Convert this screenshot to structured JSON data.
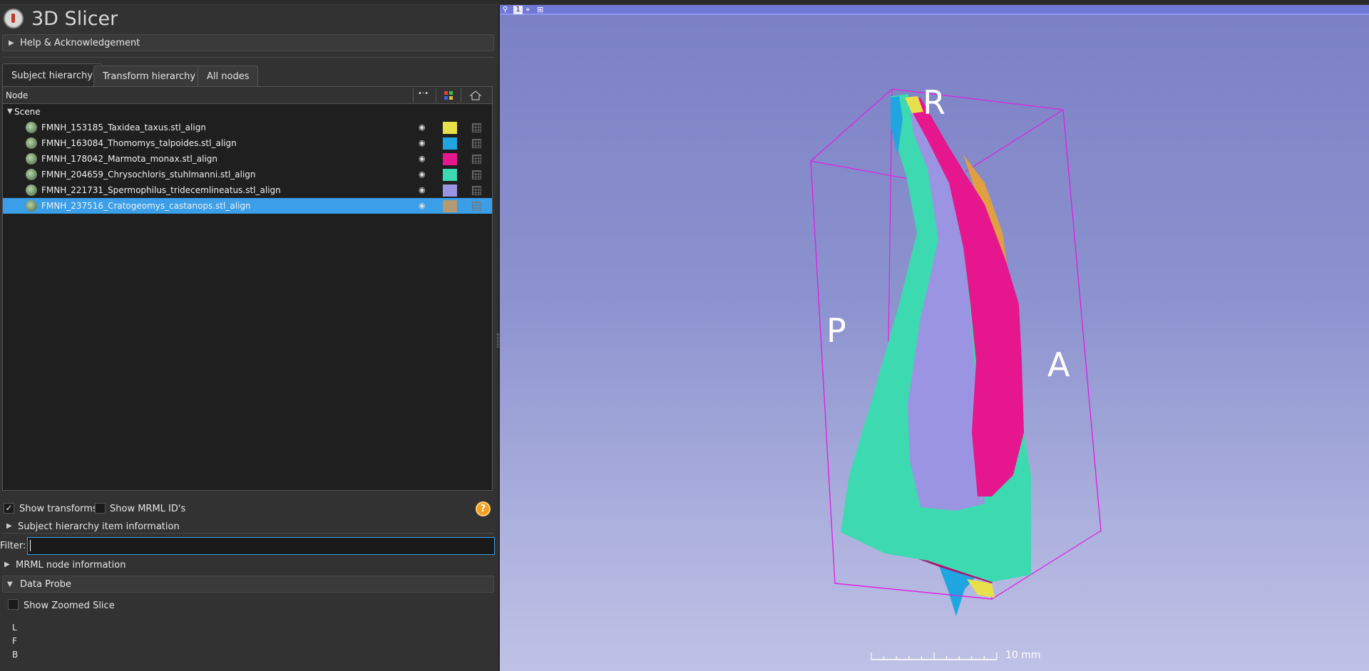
{
  "app": {
    "title": "3D Slicer"
  },
  "sections": {
    "help": "Help & Acknowledgement",
    "sh_item_info": "Subject hierarchy item information",
    "mrml_info": "MRML node information",
    "data_probe": "Data Probe"
  },
  "tabs": [
    {
      "label": "Subject hierarchy",
      "active": true
    },
    {
      "label": "Transform hierarchy",
      "active": false
    },
    {
      "label": "All nodes",
      "active": false
    }
  ],
  "tree": {
    "header": {
      "node": "Node",
      "visibility": "•·•"
    },
    "scene_label": "Scene",
    "rows": [
      {
        "label": "FMNH_153185_Taxidea_taxus.stl_align",
        "color": "#e8e04a",
        "selected": false
      },
      {
        "label": "FMNH_163084_Thomomys_talpoides.stl_align",
        "color": "#1fa6e0",
        "selected": false
      },
      {
        "label": "FMNH_178042_Marmota_monax.stl_align",
        "color": "#e6168f",
        "selected": false
      },
      {
        "label": "FMNH_204659_Chrysochloris_stuhlmanni.stl_align",
        "color": "#3dd9b0",
        "selected": false
      },
      {
        "label": "FMNH_221731_Spermophilus_tridecemlineatus.stl_align",
        "color": "#9b94e2",
        "selected": false
      },
      {
        "label": "FMNH_237516_Cratogeomys_castanops.stl_align",
        "color": "#b39a72",
        "selected": true
      }
    ]
  },
  "options": {
    "show_transforms": "Show transforms",
    "show_transforms_checked": true,
    "show_mrml_ids": "Show MRML ID's",
    "show_mrml_ids_checked": false,
    "help": "?"
  },
  "filter": {
    "label": "Filter:",
    "value": "",
    "placeholder": ""
  },
  "probe": {
    "show_zoomed_slice": "Show Zoomed Slice",
    "rows": [
      "L",
      "F",
      "B"
    ]
  },
  "view": {
    "number": "1",
    "labels": {
      "R": "R",
      "P": "P",
      "A": "A"
    },
    "scale_label": "10 mm",
    "model_colors": {
      "teal": "#3dd9b0",
      "magenta": "#e6168f",
      "lavender": "#9b94e2",
      "orange": "#e0a040",
      "blue": "#1fa6e0",
      "yellow": "#e8e04a",
      "box": "#e020e0"
    }
  }
}
